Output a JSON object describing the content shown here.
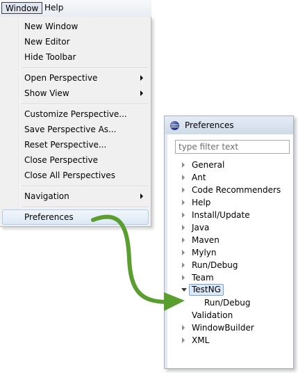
{
  "menubar": {
    "items": [
      {
        "label": "Window"
      },
      {
        "label": "Help"
      }
    ]
  },
  "menu": {
    "items": [
      {
        "label": "New Window"
      },
      {
        "label": "New Editor"
      },
      {
        "label": "Hide Toolbar"
      },
      {
        "label": "Open Perspective"
      },
      {
        "label": "Show View"
      },
      {
        "label": "Customize Perspective..."
      },
      {
        "label": "Save Perspective As..."
      },
      {
        "label": "Reset Perspective..."
      },
      {
        "label": "Close Perspective"
      },
      {
        "label": "Close All Perspectives"
      },
      {
        "label": "Navigation"
      },
      {
        "label": "Preferences"
      }
    ]
  },
  "preferences": {
    "title": "Preferences",
    "filter_placeholder": "type filter text",
    "tree": [
      {
        "label": "General"
      },
      {
        "label": "Ant"
      },
      {
        "label": "Code Recommenders"
      },
      {
        "label": "Help"
      },
      {
        "label": "Install/Update"
      },
      {
        "label": "Java"
      },
      {
        "label": "Maven"
      },
      {
        "label": "Mylyn"
      },
      {
        "label": "Run/Debug"
      },
      {
        "label": "Team"
      },
      {
        "label": "TestNG"
      },
      {
        "label": "Run/Debug"
      },
      {
        "label": "Validation"
      },
      {
        "label": "WindowBuilder"
      },
      {
        "label": "XML"
      }
    ]
  },
  "colors": {
    "arrow": "#5a9e2f",
    "selection_border": "#7da2ce",
    "menu_highlight": "#aecbec"
  }
}
